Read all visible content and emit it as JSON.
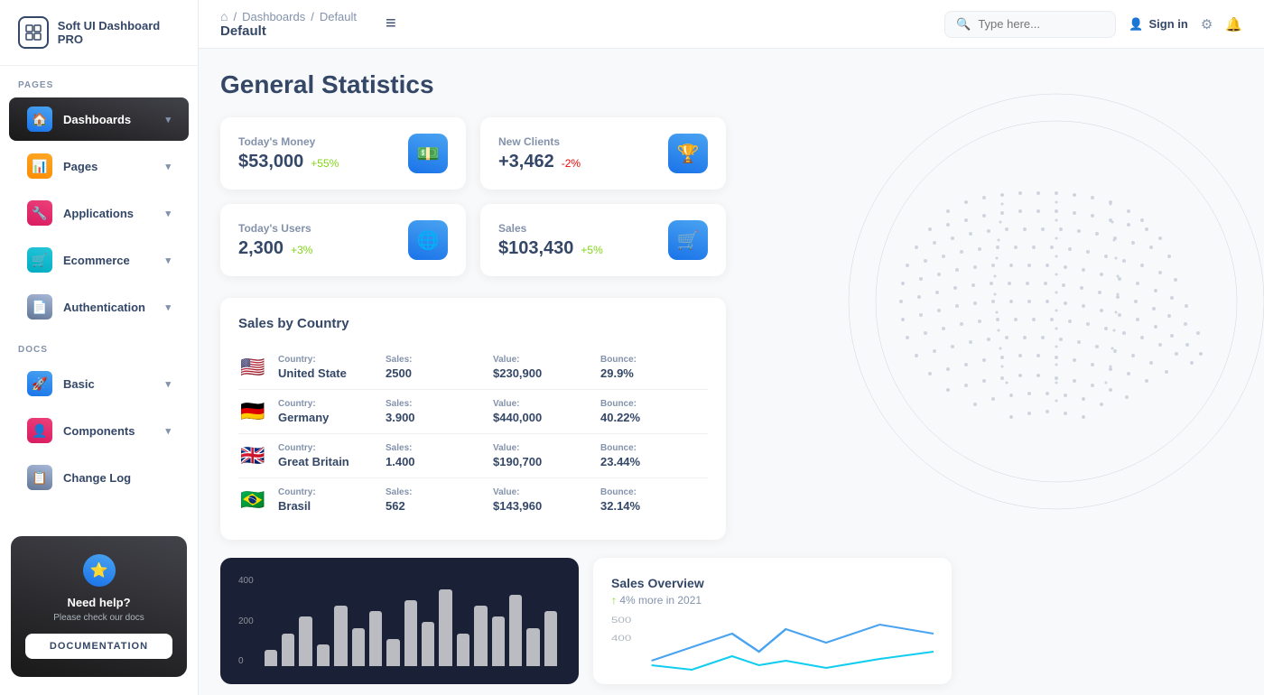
{
  "sidebar": {
    "logo_text": "Soft UI Dashboard PRO",
    "sections": [
      {
        "label": "PAGES",
        "items": [
          {
            "id": "dashboards",
            "label": "Dashboards",
            "icon": "🏠",
            "icon_class": "blue",
            "active": true,
            "has_chevron": true
          },
          {
            "id": "pages",
            "label": "Pages",
            "icon": "📊",
            "icon_class": "orange",
            "has_chevron": true
          },
          {
            "id": "applications",
            "label": "Applications",
            "icon": "🔧",
            "icon_class": "purple",
            "has_chevron": true
          },
          {
            "id": "ecommerce",
            "label": "Ecommerce",
            "icon": "🛒",
            "icon_class": "teal",
            "has_chevron": true
          },
          {
            "id": "authentication",
            "label": "Authentication",
            "icon": "📄",
            "icon_class": "gray",
            "has_chevron": true
          }
        ]
      },
      {
        "label": "DOCS",
        "items": [
          {
            "id": "basic",
            "label": "Basic",
            "icon": "🚀",
            "icon_class": "blue",
            "has_chevron": true
          },
          {
            "id": "components",
            "label": "Components",
            "icon": "👤",
            "icon_class": "purple",
            "has_chevron": true
          },
          {
            "id": "changelog",
            "label": "Change Log",
            "icon": "📋",
            "icon_class": "gray",
            "has_chevron": false
          }
        ]
      }
    ],
    "help": {
      "title": "Need help?",
      "subtitle": "Please check our docs",
      "button_label": "DOCUMENTATION"
    }
  },
  "topbar": {
    "home_icon": "⌂",
    "breadcrumb_sep": "/",
    "breadcrumb_link": "Dashboards",
    "breadcrumb_current": "Default",
    "menu_icon": "≡",
    "search_placeholder": "Type here...",
    "sign_in_label": "Sign in",
    "gear_icon": "⚙",
    "bell_icon": "🔔"
  },
  "page": {
    "title": "General Statistics"
  },
  "stats": [
    {
      "id": "money",
      "label": "Today's Money",
      "value": "$53,000",
      "change": "+55%",
      "change_type": "positive",
      "icon": "💵"
    },
    {
      "id": "clients",
      "label": "New Clients",
      "value": "+3,462",
      "change": "-2%",
      "change_type": "negative",
      "icon": "🏆"
    },
    {
      "id": "users",
      "label": "Today's Users",
      "value": "2,300",
      "change": "+3%",
      "change_type": "positive",
      "icon": "🌐"
    },
    {
      "id": "sales",
      "label": "Sales",
      "value": "$103,430",
      "change": "+5%",
      "change_type": "positive",
      "icon": "🛒"
    }
  ],
  "sales_by_country": {
    "title": "Sales by Country",
    "rows": [
      {
        "flag": "🇺🇸",
        "country_label": "Country:",
        "country": "United State",
        "sales_label": "Sales:",
        "sales": "2500",
        "value_label": "Value:",
        "value": "$230,900",
        "bounce_label": "Bounce:",
        "bounce": "29.9%"
      },
      {
        "flag": "🇩🇪",
        "country_label": "Country:",
        "country": "Germany",
        "sales_label": "Sales:",
        "sales": "3.900",
        "value_label": "Value:",
        "value": "$440,000",
        "bounce_label": "Bounce:",
        "bounce": "40.22%"
      },
      {
        "flag": "🇬🇧",
        "country_label": "Country:",
        "country": "Great Britain",
        "sales_label": "Sales:",
        "sales": "1.400",
        "value_label": "Value:",
        "value": "$190,700",
        "bounce_label": "Bounce:",
        "bounce": "23.44%"
      },
      {
        "flag": "🇧🇷",
        "country_label": "Country:",
        "country": "Brasil",
        "sales_label": "Sales:",
        "sales": "562",
        "value_label": "Value:",
        "value": "$143,960",
        "bounce_label": "Bounce:",
        "bounce": "32.14%"
      }
    ]
  },
  "chart": {
    "y_labels": [
      "400",
      "200",
      "0"
    ],
    "bars": [
      15,
      30,
      45,
      20,
      55,
      35,
      50,
      25,
      60,
      40,
      70,
      30,
      55,
      45,
      65,
      35,
      50
    ]
  },
  "sales_overview": {
    "title": "Sales Overview",
    "change": "↑ 4% more in 2021",
    "y_labels": [
      "500",
      "400"
    ]
  }
}
